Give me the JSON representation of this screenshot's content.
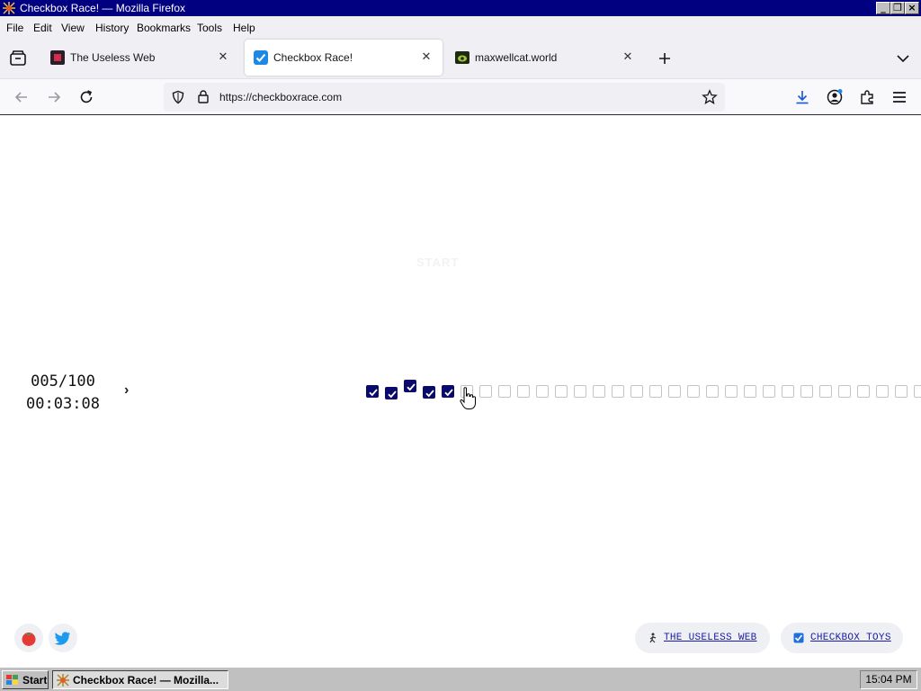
{
  "window": {
    "title": "Checkbox Race! — Mozilla Firefox"
  },
  "menu": [
    "File",
    "Edit",
    "View",
    "History",
    "Bookmarks",
    "Tools",
    "Help"
  ],
  "tabs": [
    {
      "label": "The Useless Web",
      "active": false,
      "icon": "useless-web-favicon"
    },
    {
      "label": "Checkbox Race!",
      "active": true,
      "icon": "checkbox-favicon"
    },
    {
      "label": "maxwellcat.world",
      "active": false,
      "icon": "maxwellcat-favicon"
    }
  ],
  "address_bar": {
    "url": "https://checkboxrace.com"
  },
  "game": {
    "start_label": "START",
    "progress": "005/100",
    "timer": "00:03:08",
    "next_symbol": "›",
    "checked_count": 5,
    "visible_checkbox_count": 30,
    "checked_color": "#0a0a6b"
  },
  "footer": {
    "left_icons": [
      "tomato-icon",
      "twitter-icon"
    ],
    "links": [
      {
        "label": "THE USELESS WEB",
        "icon": "useless-web-icon"
      },
      {
        "label": "CHECKBOX TOYS",
        "icon": "checkbox-icon"
      }
    ]
  },
  "taskbar": {
    "start_label": "Start",
    "task_label": "Checkbox Race! — Mozilla...",
    "clock": "15:04 PM"
  }
}
